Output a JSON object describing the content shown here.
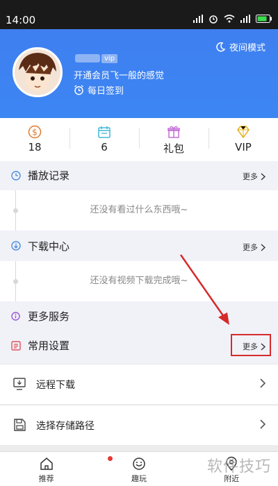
{
  "status_bar": {
    "time": "14:00"
  },
  "header": {
    "night_mode_label": "夜间模式",
    "vip_tag": "vip",
    "slogan": "开通会员飞一般的感觉",
    "checkin_label": "每日签到"
  },
  "stats": [
    {
      "icon": "coin-icon",
      "value": "18"
    },
    {
      "icon": "calendar-icon",
      "value": "6"
    },
    {
      "icon": "gift-icon",
      "value": "礼包"
    },
    {
      "icon": "diamond-icon",
      "value": "VIP"
    }
  ],
  "play_history": {
    "title": "播放记录",
    "more": "更多",
    "empty": "还没有看过什么东西哦~"
  },
  "downloads": {
    "title": "下载中心",
    "more": "更多",
    "empty": "还没有视频下载完成哦~"
  },
  "more_services": {
    "title": "更多服务"
  },
  "common_settings": {
    "title": "常用设置",
    "more": "更多"
  },
  "settings_list": [
    {
      "icon": "remote-download-icon",
      "label": "远程下载"
    },
    {
      "icon": "storage-icon",
      "label": "选择存储路径"
    }
  ],
  "tabbar": [
    {
      "icon": "home-icon",
      "label": "推荐"
    },
    {
      "icon": "game-icon",
      "label": "趣玩"
    },
    {
      "icon": "location-icon",
      "label": "附近"
    }
  ],
  "watermark": "软件技巧",
  "colors": {
    "header_blue": "#3c82f2",
    "accent_red": "#d52a2a",
    "section_bg": "#f1f1f8"
  }
}
